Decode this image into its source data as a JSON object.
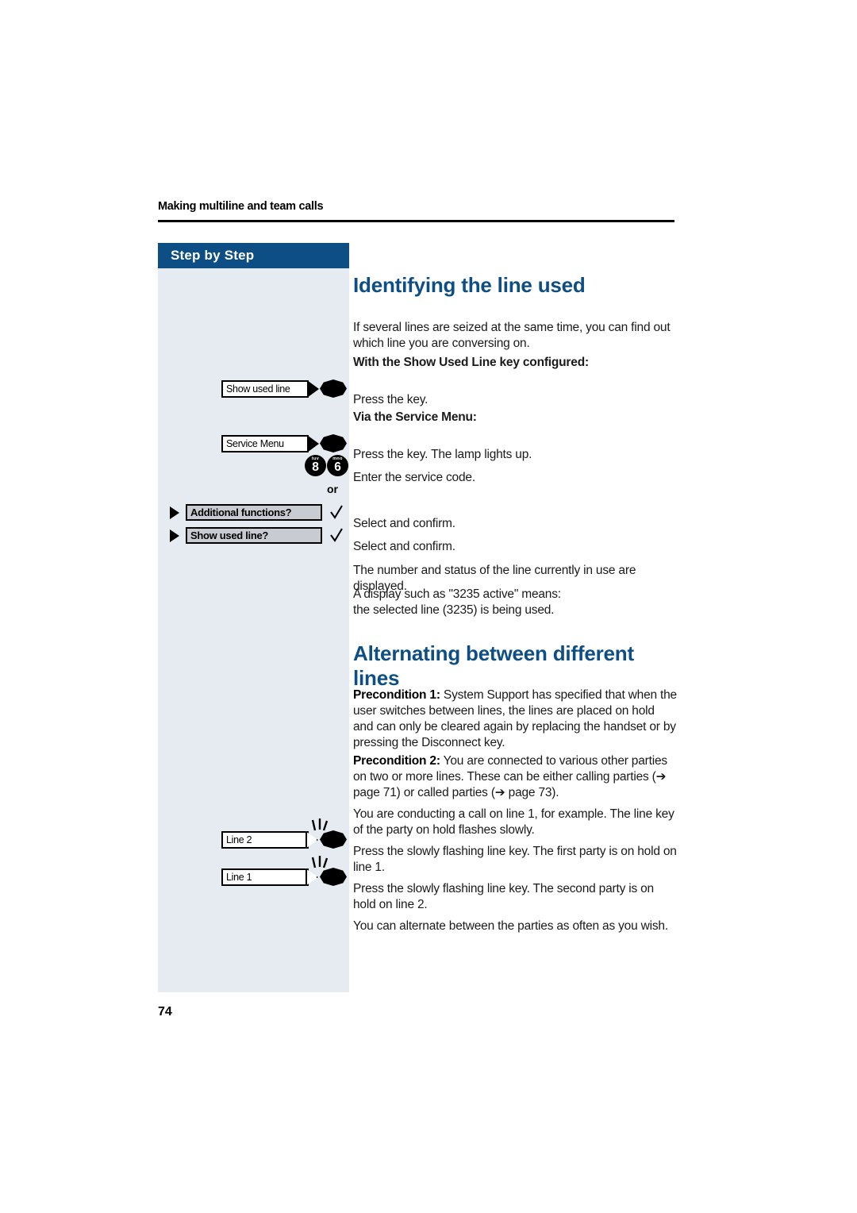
{
  "document": {
    "running_header": "Making multiline and team calls",
    "page_number": "74"
  },
  "sidebar": {
    "header_label": "Step by Step",
    "or_label": "or",
    "keys": [
      {
        "label": "Show used line",
        "type": "soft-key",
        "flashing": false
      },
      {
        "label": "Service Menu",
        "type": "soft-key",
        "flashing": false
      },
      {
        "label": "Line 2",
        "type": "line-key",
        "flashing": true
      },
      {
        "label": "Line 1",
        "type": "line-key",
        "flashing": true
      }
    ],
    "digit_keys": [
      {
        "digit": "8",
        "letters": "tuv"
      },
      {
        "digit": "6",
        "letters": "mno"
      }
    ],
    "menu_options": [
      {
        "label": "Additional functions?",
        "icon": "triangle-marker",
        "confirm": "checkmark"
      },
      {
        "label": "Show used line?",
        "icon": "triangle-marker",
        "confirm": "checkmark"
      }
    ]
  },
  "content": {
    "section_1": {
      "title": "Identifying the line used",
      "intro": "If several lines are seized at the same time, you can find out which line you are conversing on.",
      "subhead_1": "With the Show Used Line key configured:",
      "press_key": "Press the key.",
      "subhead_2": "Via the Service Menu:",
      "press_key_lamp": "Press the key. The lamp lights up.",
      "enter_code": "Enter the service code.",
      "select_confirm_1": "Select and confirm.",
      "select_confirm_2": "Select and confirm.",
      "result_1": "The number and status of the line currently in use are displayed.",
      "result_2_line_1": "A display such as \"3235 active\" means:",
      "result_2_line_2": "the selected line (3235) is being used."
    },
    "section_2": {
      "title": "Alternating between different lines",
      "precondition_1_label": "Precondition 1:",
      "precondition_1_text": " System Support has specified that when the user switches between lines, the lines are placed on hold and can only be cleared again by replacing the handset or by pressing the Disconnect key.",
      "precondition_2_label": "Precondition 2:",
      "precondition_2_text": " You are connected to various other parties on two or more lines. These can be either calling parties (➔ page 71) or called parties (➔ page 73).",
      "conducting_call": "You are conducting a call on line 1, for example. The line key of the party on hold flashes slowly.",
      "press_line_2": "Press the slowly flashing line key. The first party is on hold on line 1.",
      "press_line_1": "Press the slowly flashing line key. The second party is on hold on line 2.",
      "alternate_note": "You can alternate between the parties as often as you wish."
    }
  },
  "colors": {
    "accent_blue": "#0d4f85",
    "sidebar_bg": "#e5ebf1",
    "menu_box_fill": "#c8ccd2"
  }
}
